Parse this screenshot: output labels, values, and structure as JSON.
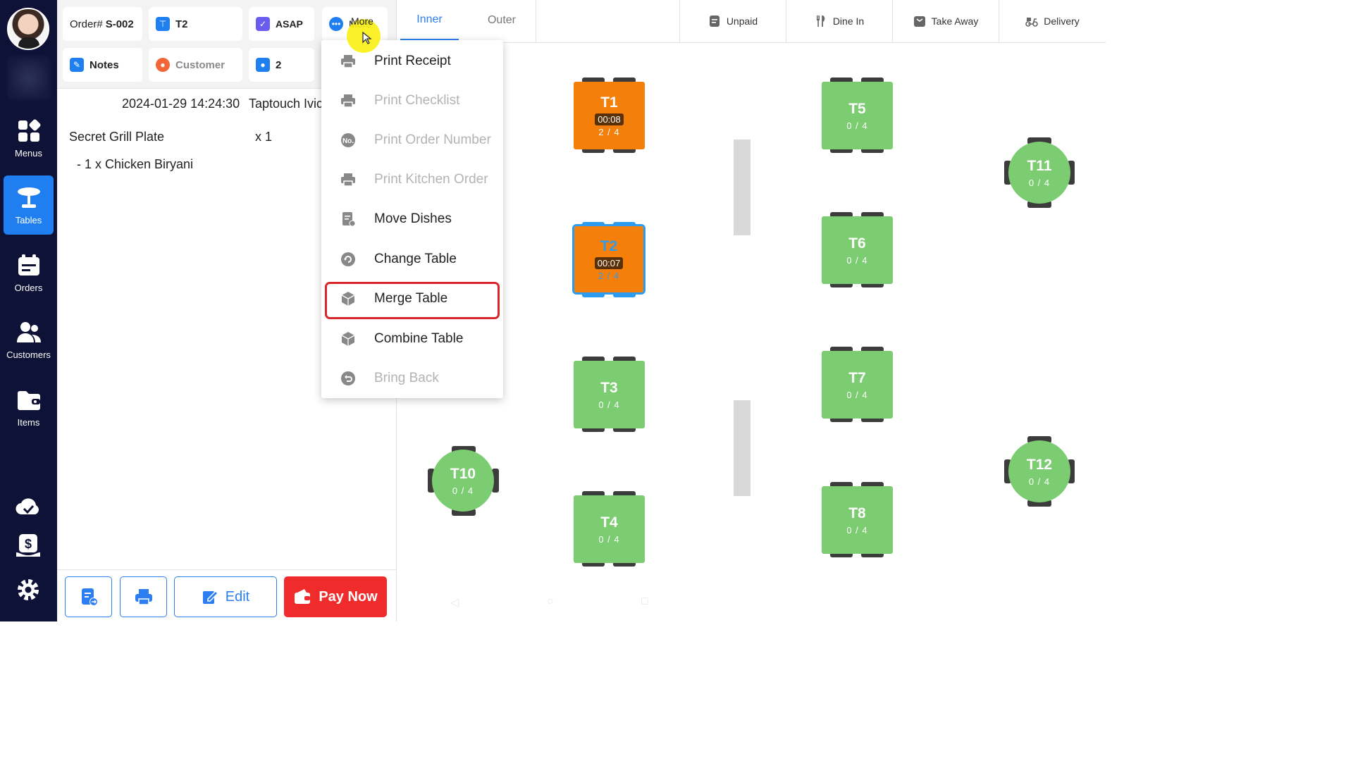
{
  "sidebar": {
    "items": [
      {
        "label": "Menus",
        "icon": "grid-icon"
      },
      {
        "label": "Tables",
        "icon": "table-icon",
        "active": true
      },
      {
        "label": "Orders",
        "icon": "orders-icon"
      },
      {
        "label": "Customers",
        "icon": "customers-icon"
      },
      {
        "label": "Items",
        "icon": "folder-icon"
      }
    ],
    "bottom_icons": [
      "cloud-check-icon",
      "cash-icon",
      "gear-icon"
    ]
  },
  "order": {
    "chips": {
      "order_prefix": "Order#",
      "order_number": "S-002",
      "table": "T2",
      "timing": "ASAP",
      "more": "More",
      "notes": "Notes",
      "customer": "Customer",
      "guests": "2"
    },
    "datetime": "2024-01-29 14:24:30",
    "staff": "Taptouch Ivic",
    "items": [
      {
        "name": "Secret Grill Plate",
        "qty": "x 1"
      }
    ],
    "modifiers": [
      "- 1 x Chicken Biryani"
    ],
    "buttons": {
      "edit": "Edit",
      "pay": "Pay Now"
    }
  },
  "dropdown": {
    "items": [
      {
        "label": "Print Receipt",
        "icon": "printer-icon",
        "enabled": true
      },
      {
        "label": "Print Checklist",
        "icon": "printer-icon",
        "enabled": false
      },
      {
        "label": "Print Order Number",
        "icon": "number-icon",
        "enabled": false
      },
      {
        "label": "Print Kitchen Order",
        "icon": "printer-icon",
        "enabled": false
      },
      {
        "label": "Move Dishes",
        "icon": "move-dishes-icon",
        "enabled": true
      },
      {
        "label": "Change Table",
        "icon": "swap-icon",
        "enabled": true
      },
      {
        "label": "Merge Table",
        "icon": "box-icon",
        "enabled": true,
        "highlighted": true
      },
      {
        "label": "Combine Table",
        "icon": "box-icon",
        "enabled": true
      },
      {
        "label": "Bring Back",
        "icon": "undo-icon",
        "enabled": false
      }
    ]
  },
  "floor": {
    "tabs": [
      {
        "label": "Inner",
        "active": true
      },
      {
        "label": "Outer",
        "active": false
      }
    ],
    "filters": [
      "Unpaid",
      "Dine In",
      "Take Away",
      "Delivery"
    ],
    "tables": [
      {
        "name": "T1",
        "seats": "2 / 4",
        "time": "00:08",
        "status": "occupied"
      },
      {
        "name": "T2",
        "seats": "2 / 4",
        "time": "00:07",
        "status": "selected"
      },
      {
        "name": "T3",
        "seats": "0 / 4",
        "status": "free"
      },
      {
        "name": "T4",
        "seats": "0 / 4",
        "status": "free"
      },
      {
        "name": "T5",
        "seats": "0 / 4",
        "status": "free"
      },
      {
        "name": "T6",
        "seats": "0 / 4",
        "status": "free"
      },
      {
        "name": "T7",
        "seats": "0 / 4",
        "status": "free"
      },
      {
        "name": "T8",
        "seats": "0 / 4",
        "status": "free"
      },
      {
        "name": "T10",
        "seats": "0 / 4",
        "status": "free"
      },
      {
        "name": "T11",
        "seats": "0 / 4",
        "status": "free"
      },
      {
        "name": "T12",
        "seats": "0 / 4",
        "status": "free"
      }
    ]
  },
  "colors": {
    "sidebar": "#0e1236",
    "accent": "#1f7ff0",
    "free_table": "#7ccc72",
    "occupied_table": "#f57f0b",
    "pay": "#f02b2b",
    "highlight": "#d9262b"
  }
}
